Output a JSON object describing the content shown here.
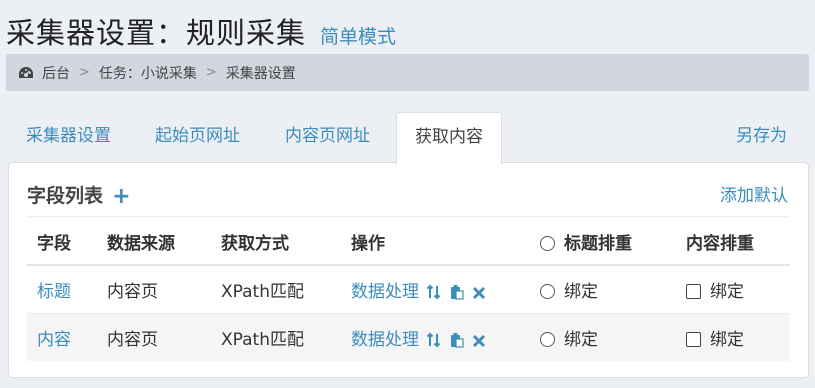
{
  "header": {
    "title": "采集器设置：规则采集",
    "mode_link": "简单模式"
  },
  "breadcrumb": {
    "home": "后台",
    "task": "任务：小说采集",
    "current": "采集器设置",
    "separator": ">"
  },
  "tabs": {
    "collector_settings": "采集器设置",
    "start_url": "起始页网址",
    "content_url": "内容页网址",
    "get_content": "获取内容",
    "save_as": "另存为",
    "active": "获取内容"
  },
  "fields_panel": {
    "title": "字段列表",
    "add_default": "添加默认",
    "columns": [
      "字段",
      "数据来源",
      "获取方式",
      "操作",
      "标题排重",
      "内容排重"
    ],
    "rows": [
      {
        "field": "标题",
        "source": "内容页",
        "method": "XPath匹配",
        "operation": "数据处理",
        "title_dedup": "绑定",
        "content_dedup": "绑定"
      },
      {
        "field": "内容",
        "source": "内容页",
        "method": "XPath匹配",
        "operation": "数据处理",
        "title_dedup": "绑定",
        "content_dedup": "绑定"
      }
    ]
  },
  "colors": {
    "accent": "#3c8dbc",
    "background": "#ecf0f5",
    "breadcrumb_bg": "#d2d6de"
  }
}
